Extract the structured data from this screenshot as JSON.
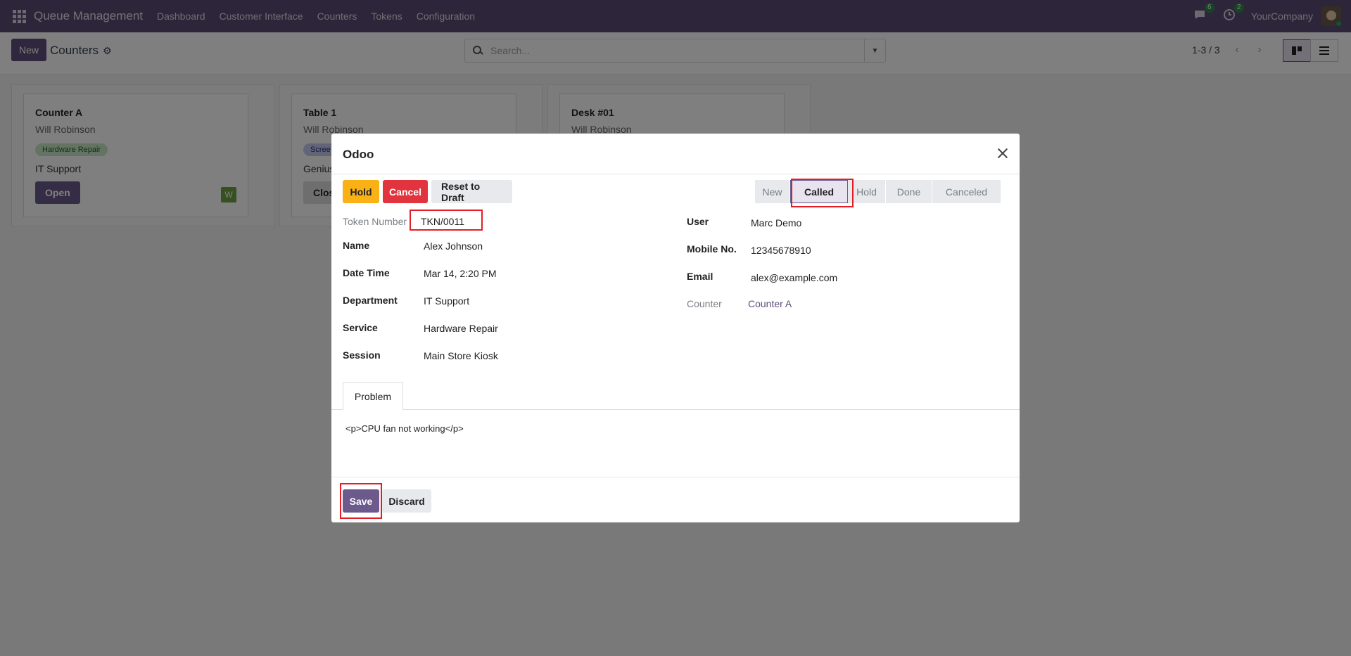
{
  "navbar": {
    "app_name": "Queue Management",
    "menu": [
      "Dashboard",
      "Customer Interface",
      "Counters",
      "Tokens",
      "Configuration"
    ],
    "chat_badge": "6",
    "activity_badge": "2",
    "company": "YourCompany"
  },
  "control": {
    "new_label": "New",
    "title": "Counters",
    "search_placeholder": "Search...",
    "pager": "1-3 / 3"
  },
  "kanban": [
    {
      "title": "Counter A",
      "user": "Will Robinson",
      "tag": "Hardware Repair",
      "dept": "IT Support",
      "button": "Open",
      "avatar": "W"
    },
    {
      "title": "Table 1",
      "user": "Will Robinson",
      "tag": "Scree",
      "dept": "Genius",
      "button": "Clos"
    },
    {
      "title": "Desk #01",
      "user": "Will Robinson"
    }
  ],
  "modal": {
    "title": "Odoo",
    "buttons": {
      "hold": "Hold",
      "cancel": "Cancel",
      "reset": "Reset to Draft"
    },
    "stages": [
      "New",
      "Called",
      "Hold",
      "Done",
      "Canceled"
    ],
    "active_stage": "Called",
    "fields_left": [
      {
        "label": "Token Number",
        "value": "TKN/0011"
      },
      {
        "label": "Name",
        "value": "Alex Johnson"
      },
      {
        "label": "Date Time",
        "value": "Mar 14, 2:20 PM"
      },
      {
        "label": "Department",
        "value": "IT Support"
      },
      {
        "label": "Service",
        "value": "Hardware Repair"
      },
      {
        "label": "Session",
        "value": "Main Store Kiosk"
      }
    ],
    "fields_right": [
      {
        "label": "User",
        "value": "Marc Demo"
      },
      {
        "label": "Mobile No.",
        "value": "12345678910"
      },
      {
        "label": "Email",
        "value": "alex@example.com"
      },
      {
        "label": "Counter",
        "value": "Counter A"
      }
    ],
    "tab": "Problem",
    "problem": "<p>CPU fan not working</p>",
    "save": "Save",
    "discard": "Discard"
  },
  "colors": {
    "navbar": "#5a4b73",
    "primary": "#6b5a8b",
    "highlight": "#e31d23",
    "hold": "#f9b116",
    "cancel": "#e2343e"
  }
}
